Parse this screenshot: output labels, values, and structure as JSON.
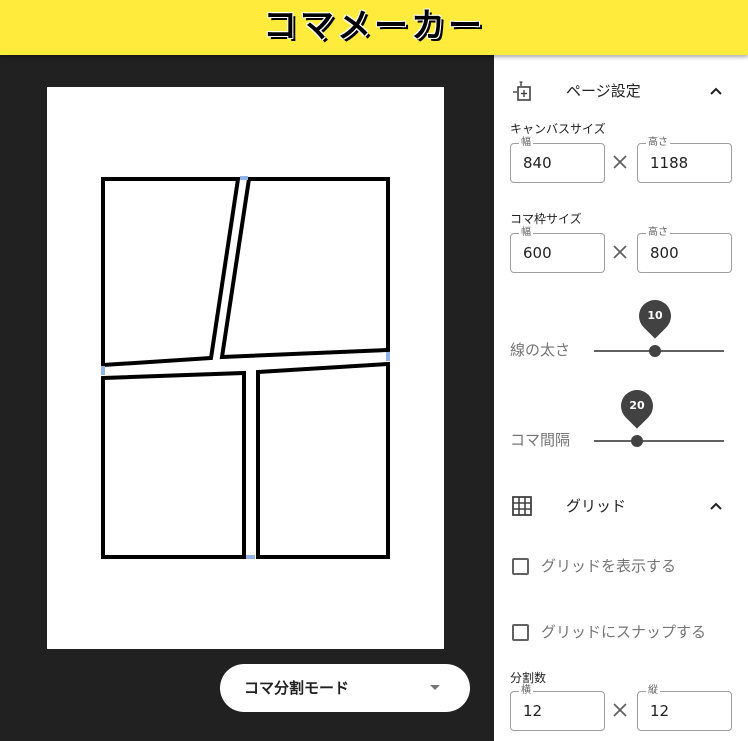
{
  "app": {
    "logo_text": "コマメーカー",
    "brand_color": "#ffeb3b"
  },
  "canvas": {
    "mode_select": {
      "selected": "コマ分割モード",
      "icon": "caret-down-icon"
    }
  },
  "panel": {
    "page_settings": {
      "title": "ページ設定",
      "icon": "page-settings-icon",
      "canvas_size": {
        "label": "キャンバスサイズ",
        "width_legend": "幅",
        "width_value": "840",
        "height_legend": "高さ",
        "height_value": "1188"
      },
      "frame_size": {
        "label": "コマ枠サイズ",
        "width_legend": "幅",
        "width_value": "600",
        "height_legend": "高さ",
        "height_value": "800"
      },
      "line_width": {
        "label": "線の太さ",
        "value": "10",
        "level": 0.47
      },
      "panel_gap": {
        "label": "コマ間隔",
        "value": "20",
        "level": 0.33
      }
    },
    "grid": {
      "title": "グリッド",
      "icon": "grid-icon",
      "show_grid_label": "グリッドを表示する",
      "snap_grid_label": "グリッドにスナップする",
      "divisions": {
        "label": "分割数",
        "h_legend": "横",
        "h_value": "12",
        "v_legend": "縦",
        "v_value": "12"
      }
    }
  }
}
